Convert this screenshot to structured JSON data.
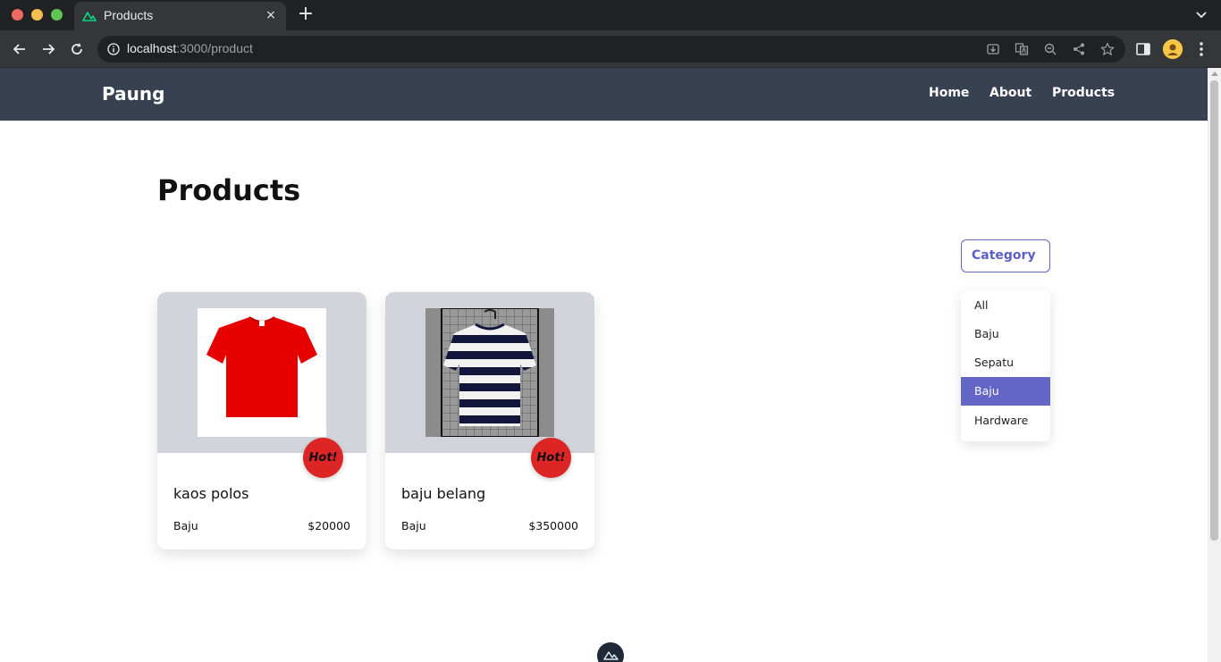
{
  "browser": {
    "tab_title": "Products",
    "tab_close": "×",
    "new_tab": "+",
    "url_host": "localhost",
    "url_rest": ":3000/product",
    "colors": {
      "tab_bar": "#202124",
      "toolbar": "#35363a",
      "avatar": "#f6c744"
    }
  },
  "site": {
    "brand": "Paung",
    "nav": [
      {
        "label": "Home"
      },
      {
        "label": "About"
      },
      {
        "label": "Products"
      }
    ],
    "colors": {
      "nav_bg": "#374151",
      "accent": "#6366c4",
      "hot": "#dc2626"
    }
  },
  "main": {
    "title": "Products",
    "category_button": "Category",
    "category_options": [
      {
        "label": "All",
        "selected": false
      },
      {
        "label": "Baju",
        "selected": false
      },
      {
        "label": "Sepatu",
        "selected": false
      },
      {
        "label": "Baju",
        "selected": true
      },
      {
        "label": "Hardware",
        "selected": false
      }
    ],
    "products": [
      {
        "name": "kaos polos",
        "category": "Baju",
        "price": "$20000",
        "badge": "Hot!",
        "image": "red-tshirt"
      },
      {
        "name": "baju belang",
        "category": "Baju",
        "price": "$350000",
        "badge": "Hot!",
        "image": "striped-tshirt"
      }
    ]
  }
}
